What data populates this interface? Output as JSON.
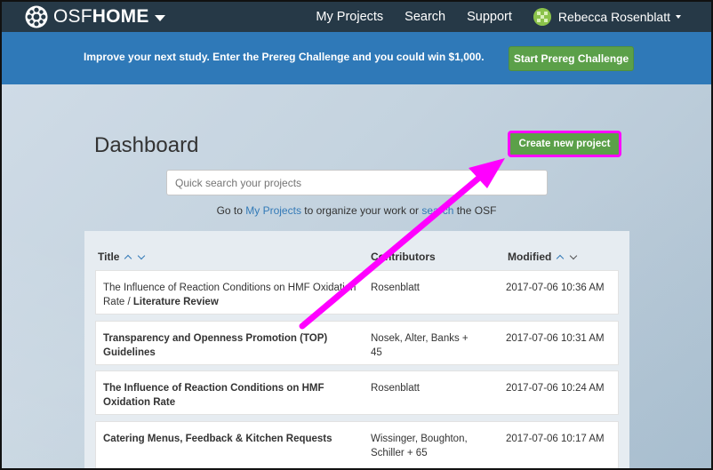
{
  "navbar": {
    "brand_osf": "OSF",
    "brand_home": "HOME",
    "links": [
      "My Projects",
      "Search",
      "Support"
    ],
    "user_name": "Rebecca Rosenblatt"
  },
  "banner": {
    "text": "Improve your next study. Enter the Prereg Challenge and you could win $1,000.",
    "button": "Start Prereg Challenge"
  },
  "dashboard": {
    "title": "Dashboard",
    "create_button": "Create new project",
    "search_placeholder": "Quick search your projects",
    "goto_prefix": "Go to ",
    "goto_link1": "My Projects",
    "goto_middle": " to organize your work or ",
    "goto_link2": "search",
    "goto_suffix": " the OSF"
  },
  "table": {
    "headers": {
      "title": "Title",
      "contributors": "Contributors",
      "modified": "Modified"
    },
    "rows": [
      {
        "title_prefix": "The Influence of Reaction Conditions on HMF Oxidation Rate / ",
        "title_bold": "Literature Review",
        "contributors": "Rosenblatt",
        "modified": "2017-07-06 10:36 AM"
      },
      {
        "title_prefix": "",
        "title_bold": "Transparency and Openness Promotion (TOP) Guidelines",
        "contributors": "Nosek, Alter, Banks + 45",
        "modified": "2017-07-06 10:31 AM"
      },
      {
        "title_prefix": "",
        "title_bold": "The Influence of Reaction Conditions on HMF Oxidation Rate",
        "contributors": "Rosenblatt",
        "modified": "2017-07-06 10:24 AM"
      },
      {
        "title_prefix": "",
        "title_bold": "Catering Menus, Feedback & Kitchen Requests",
        "contributors": "Wissinger, Boughton, Schiller + 65",
        "modified": "2017-07-06 10:17 AM"
      }
    ]
  },
  "colors": {
    "navbar": "#263947",
    "banner": "#2f79b8",
    "button_green": "#5ba049",
    "highlight": "#ff00ff",
    "link": "#337ab7"
  }
}
